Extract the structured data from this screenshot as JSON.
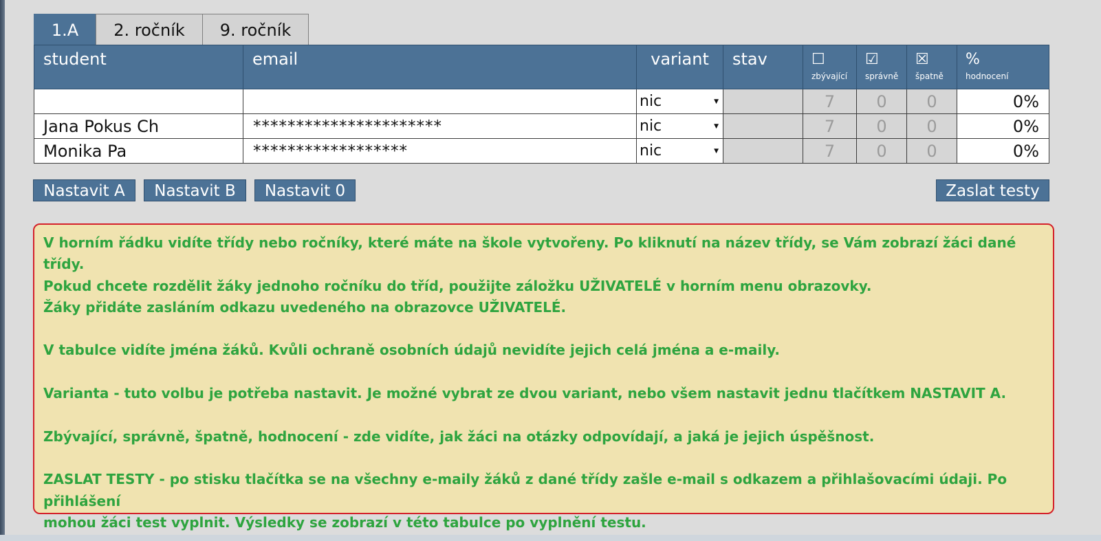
{
  "tabs": [
    "1.A",
    "2. ročník",
    "9. ročník"
  ],
  "table": {
    "headers": {
      "student": "student",
      "email": "email",
      "variant": "variant",
      "stav": "stav",
      "remaining_icon": "☐",
      "remaining": "zbývající",
      "correct_icon": "☑",
      "correct": "správně",
      "wrong_icon": "☒",
      "wrong": "špatně",
      "score_icon": "%",
      "score": "hodnocení"
    },
    "rows": [
      {
        "student": "",
        "email": "",
        "variant": "nic",
        "stav": "",
        "remaining": "7",
        "correct": "0",
        "wrong": "0",
        "score": "0%"
      },
      {
        "student": "Jana Pokus Ch",
        "email": "**********************",
        "variant": "nic",
        "stav": "",
        "remaining": "7",
        "correct": "0",
        "wrong": "0",
        "score": "0%"
      },
      {
        "student": "Monika Pa",
        "email": "******************",
        "variant": "nic",
        "stav": "",
        "remaining": "7",
        "correct": "0",
        "wrong": "0",
        "score": "0%"
      }
    ]
  },
  "buttons": {
    "set_a": "Nastavit A",
    "set_b": "Nastavit B",
    "set_0": "Nastavit 0",
    "send_tests": "Zaslat testy"
  },
  "info": {
    "p1": "V horním řádku vidíte třídy nebo ročníky, které máte na škole vytvořeny. Po kliknutí na název třídy, se Vám zobrazí žáci dané třídy.",
    "p2": "Pokud chcete rozdělit žáky jednoho ročníku do tříd, použijte záložku UŽIVATELÉ v horním menu obrazovky.",
    "p3": "Žáky přidáte zasláním odkazu uvedeného na obrazovce UŽIVATELÉ.",
    "p4": "V tabulce vidíte jména žáků. Kvůli ochraně osobních údajů nevidíte jejich celá jména a e-maily.",
    "p5": "Varianta - tuto volbu je potřeba nastavit. Je možné vybrat ze dvou variant, nebo všem nastavit jednu tlačítkem NASTAVIT A.",
    "p6": "Zbývající, správně, špatně, hodnocení - zde vidíte, jak žáci na otázky odpovídají, a jaká je jejich úspěšnost.",
    "p7": "ZASLAT TESTY - po stisku tlačítka se na všechny e-maily žáků z dané třídy zašle e-mail s odkazem a přihlašovacími údaji. Po přihlášení",
    "p8": "mohou žáci test vyplnit. Výsledky se zobrazí v této tabulce po vyplnění testu."
  },
  "colors": {
    "header_blue": "#4c7296",
    "info_bg": "#f0e3b0",
    "info_border": "#d4202a",
    "info_text": "#2ea43f"
  }
}
